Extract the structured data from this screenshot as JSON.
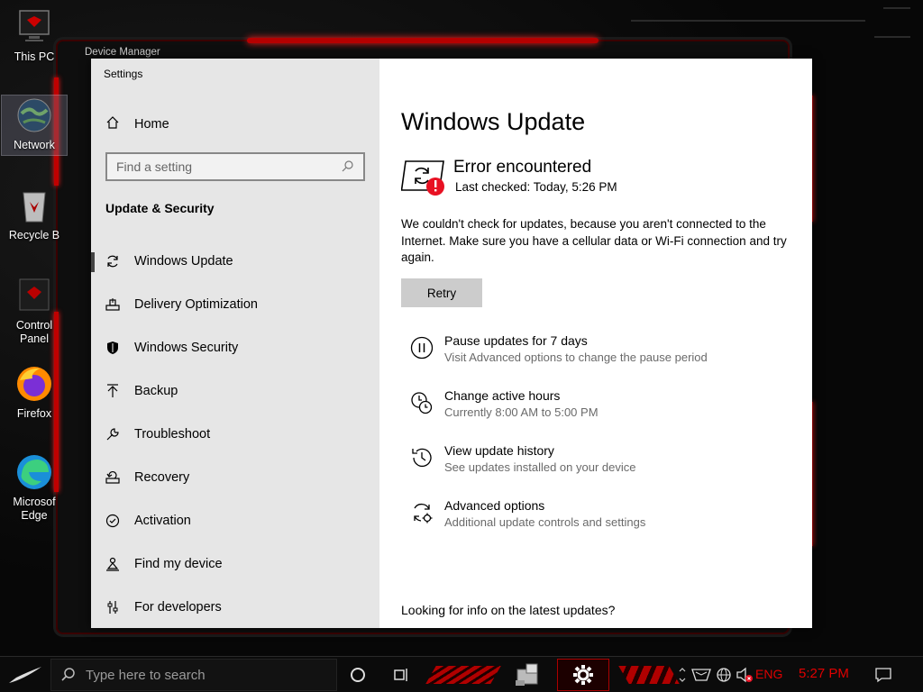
{
  "desktop": {
    "icons": [
      {
        "label": "This PC",
        "icon": "this-pc-icon"
      },
      {
        "label": "Network",
        "icon": "network-icon"
      },
      {
        "label": "Recycle B",
        "icon": "recycle-bin-icon"
      },
      {
        "label": "Control Panel",
        "icon": "control-panel-icon"
      },
      {
        "label": "Firefox",
        "icon": "firefox-icon"
      },
      {
        "label": "Microsof Edge",
        "icon": "edge-icon"
      }
    ],
    "background_window_title": "Device Manager"
  },
  "window": {
    "title": "Settings",
    "controls": {
      "minimize": "—",
      "maximize": "☐",
      "close": "✕"
    }
  },
  "nav": {
    "home": "Home",
    "search_placeholder": "Find a setting",
    "section_title": "Update & Security",
    "items": [
      {
        "label": "Windows Update",
        "icon": "sync-icon",
        "active": true
      },
      {
        "label": "Delivery Optimization",
        "icon": "delivery-optimization-icon"
      },
      {
        "label": "Windows Security",
        "icon": "shield-icon"
      },
      {
        "label": "Backup",
        "icon": "backup-arrow-icon"
      },
      {
        "label": "Troubleshoot",
        "icon": "wrench-icon"
      },
      {
        "label": "Recovery",
        "icon": "recovery-icon"
      },
      {
        "label": "Activation",
        "icon": "check-circle-icon"
      },
      {
        "label": "Find my device",
        "icon": "person-pin-icon"
      },
      {
        "label": "For developers",
        "icon": "developer-sliders-icon"
      }
    ]
  },
  "content": {
    "title": "Windows Update",
    "status": {
      "title": "Error encountered",
      "last_checked": "Last checked: Today, 5:26 PM"
    },
    "message": "We couldn't check for updates, because you aren't connected to the Internet. Make sure you have a cellular data or Wi-Fi connection and try again.",
    "retry_label": "Retry",
    "options": [
      {
        "title": "Pause updates for 7 days",
        "subtitle": "Visit Advanced options to change the pause period",
        "icon": "pause-icon"
      },
      {
        "title": "Change active hours",
        "subtitle": "Currently 8:00 AM to 5:00 PM",
        "icon": "clock-icon"
      },
      {
        "title": "View update history",
        "subtitle": "See updates installed on your device",
        "icon": "history-icon"
      },
      {
        "title": "Advanced options",
        "subtitle": "Additional update controls and settings",
        "icon": "advanced-sync-gear-icon"
      }
    ],
    "footer_link": "Looking for info on the latest updates?"
  },
  "taskbar": {
    "search_placeholder": "Type here to search",
    "language": "ENG",
    "time": "5:27 PM"
  },
  "colors": {
    "accent_red": "#e00000",
    "nav_bg": "#e6e6e6",
    "error_badge": "#e81123"
  }
}
